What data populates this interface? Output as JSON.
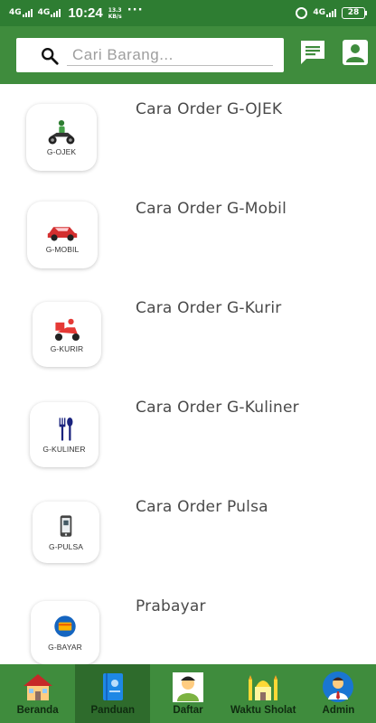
{
  "status_bar": {
    "network_1": "4G",
    "network_2": "4G",
    "time": "10:24",
    "speed_value": "13.3",
    "speed_unit": "KB/s",
    "more": "···",
    "network_right": "4G",
    "battery": "28",
    "icons": [
      "signal-icon",
      "alarm-icon",
      "battery-icon"
    ]
  },
  "header": {
    "search_placeholder": "Cari Barang...",
    "search_value": "",
    "icons": [
      "search-icon",
      "chat-icon",
      "profile-icon"
    ]
  },
  "menu_items": [
    {
      "title": "Cara Order G-OJEK",
      "card_label": "G-OJEK",
      "icon": "motorbike-icon"
    },
    {
      "title": "Cara Order G-Mobil",
      "card_label": "G-MOBIL",
      "icon": "car-icon"
    },
    {
      "title": "Cara Order G-Kurir",
      "card_label": "G-KURIR",
      "icon": "delivery-scooter-icon"
    },
    {
      "title": "Cara Order G-Kuliner",
      "card_label": "G-KULINER",
      "icon": "fork-spoon-icon"
    },
    {
      "title": "Cara Order Pulsa",
      "card_label": "G-PULSA",
      "icon": "phone-icon"
    },
    {
      "title": "Prabayar",
      "card_label": "G-BAYAR",
      "icon": "payment-icon"
    }
  ],
  "bottom_nav": [
    {
      "label": "Beranda",
      "icon": "house-icon",
      "active": false
    },
    {
      "label": "Panduan",
      "icon": "guide-book-icon",
      "active": true
    },
    {
      "label": "Daftar",
      "icon": "register-person-icon",
      "active": false
    },
    {
      "label": "Waktu Sholat",
      "icon": "mosque-icon",
      "active": false
    },
    {
      "label": "Admin",
      "icon": "admin-avatar-icon",
      "active": false
    }
  ],
  "colors": {
    "primary": "#3f8c3d",
    "primary_dark": "#2e7d32",
    "nav_active": "#2e6b2c"
  }
}
